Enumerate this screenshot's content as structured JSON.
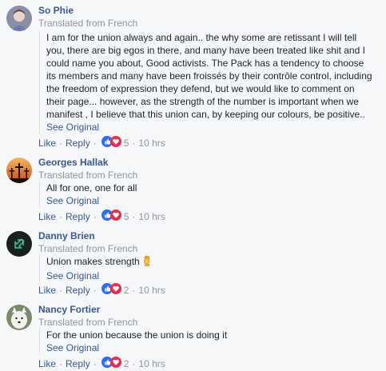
{
  "comments": [
    {
      "author": "So Phie",
      "translated_label": "Translated from French",
      "lines": [
        "I am for the union always and again.. the why some are retissant I will tell",
        "you, there are big egos in there, and many have been treated like shit and I",
        "could name you about, Good activists. The Pack has a tendency to choose",
        "its members and many have been froissés by their contrôle control, including",
        "the freedom of expression they defend, but we would like to comment on",
        "their page... however, as the strength of the number is important when we",
        "manifest , I believe that this union can, by keeping our colours, be positive.."
      ],
      "see_original": "See Original",
      "like": "Like",
      "reply": "Reply",
      "reaction_count": "5",
      "time": "10 hrs"
    },
    {
      "author": "Georges Hallak",
      "translated_label": "Translated from French",
      "lines": [
        "All for one, one for all"
      ],
      "see_original": "See Original",
      "like": "Like",
      "reply": "Reply",
      "reaction_count": "5",
      "time": "10 hrs"
    },
    {
      "author": "Danny Brien",
      "translated_label": "Translated from French",
      "lines": [
        "Union makes strength"
      ],
      "see_original": "See Original",
      "like": "Like",
      "reply": "Reply",
      "reaction_count": "2",
      "time": "10 hrs"
    },
    {
      "author": "Nancy Fortier",
      "translated_label": "Translated from French",
      "lines": [
        "For the union because the union is doing it"
      ],
      "see_original": "See Original",
      "like": "Like",
      "reply": "Reply",
      "reaction_count": "2",
      "time": "10 hrs"
    }
  ],
  "separator": "·",
  "colors": {
    "link": "#365899",
    "meta": "#90949c",
    "like_blue": "#2b6cf6",
    "love_red": "#f0284a"
  },
  "icons": {
    "like_reaction": "thumbs-up-icon",
    "love_reaction": "heart-icon",
    "fist_emoji": "raised-fist-icon"
  }
}
